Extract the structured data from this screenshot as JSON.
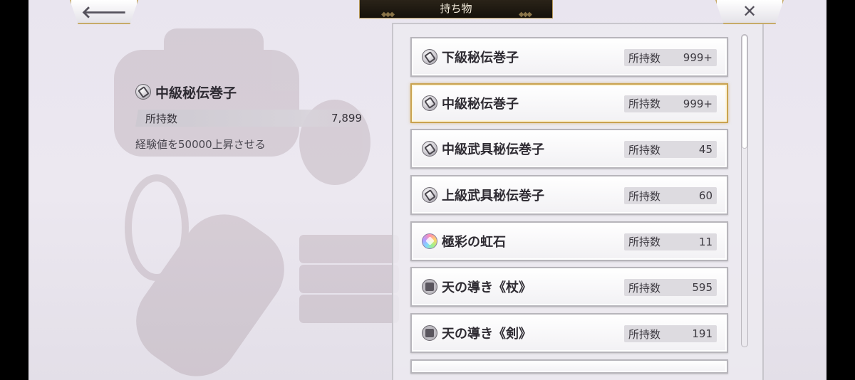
{
  "header": {
    "title": "持ち物",
    "back_icon": "back-arrow-icon",
    "close_icon": "close-icon"
  },
  "detail": {
    "name": "中級秘伝巻子",
    "count_label": "所持数",
    "count_value": "7,899",
    "description": "経験値を50000上昇させる",
    "icon": "scroll-icon"
  },
  "list": {
    "count_label": "所持数",
    "items": [
      {
        "name": "下級秘伝巻子",
        "count": "999+",
        "icon": "scroll-icon"
      },
      {
        "name": "中級秘伝巻子",
        "count": "999+",
        "icon": "scroll-icon",
        "selected": true
      },
      {
        "name": "中級武具秘伝巻子",
        "count": "45",
        "icon": "scroll-icon"
      },
      {
        "name": "上級武具秘伝巻子",
        "count": "60",
        "icon": "scroll-icon"
      },
      {
        "name": "極彩の虹石",
        "count": "11",
        "icon": "rainbow-stone-icon"
      },
      {
        "name": "天の導き《杖》",
        "count": "595",
        "icon": "heaven-guide-icon"
      },
      {
        "name": "天の導き《剣》",
        "count": "191",
        "icon": "heaven-guide-icon"
      }
    ]
  },
  "colors": {
    "selected_border": "#c9a24f",
    "title_bar": "#1b160e",
    "frame_gold": "#c7ab68"
  }
}
